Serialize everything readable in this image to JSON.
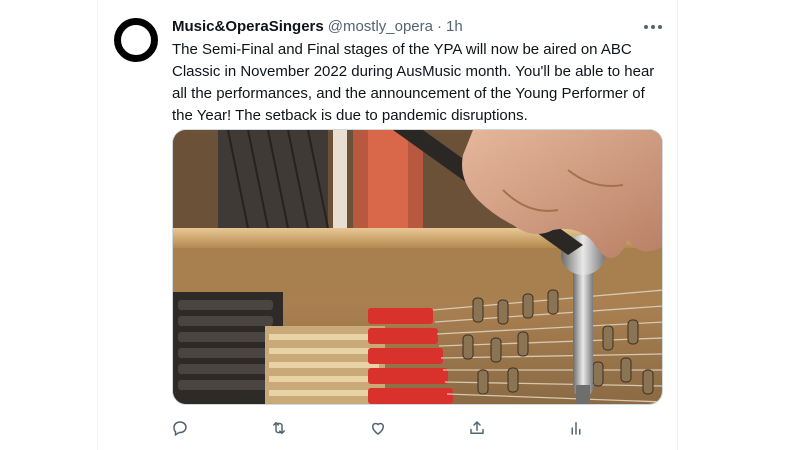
{
  "tweet": {
    "author": {
      "display_name": "Music&OperaSingers",
      "handle": "@mostly_opera"
    },
    "separator": "·",
    "time": "1h",
    "text": "The Semi-Final and Final stages of the YPA will now be aired on ABC Classic in November 2022 during AusMusic month. You'll be able to hear all the performances, and the announcement of the Young Performer of the Year! The setback is due to pandemic disruptions.",
    "media": {
      "description_icon": "photo-piano-tuning"
    },
    "actions": [
      {
        "name": "reply",
        "icon": "reply-icon"
      },
      {
        "name": "retweet",
        "icon": "retweet-icon"
      },
      {
        "name": "like",
        "icon": "heart-icon"
      },
      {
        "name": "share",
        "icon": "share-icon"
      },
      {
        "name": "analytics",
        "icon": "analytics-icon"
      }
    ]
  },
  "colors": {
    "text_primary": "#0f1419",
    "text_secondary": "#536471",
    "icon": "#536471"
  }
}
